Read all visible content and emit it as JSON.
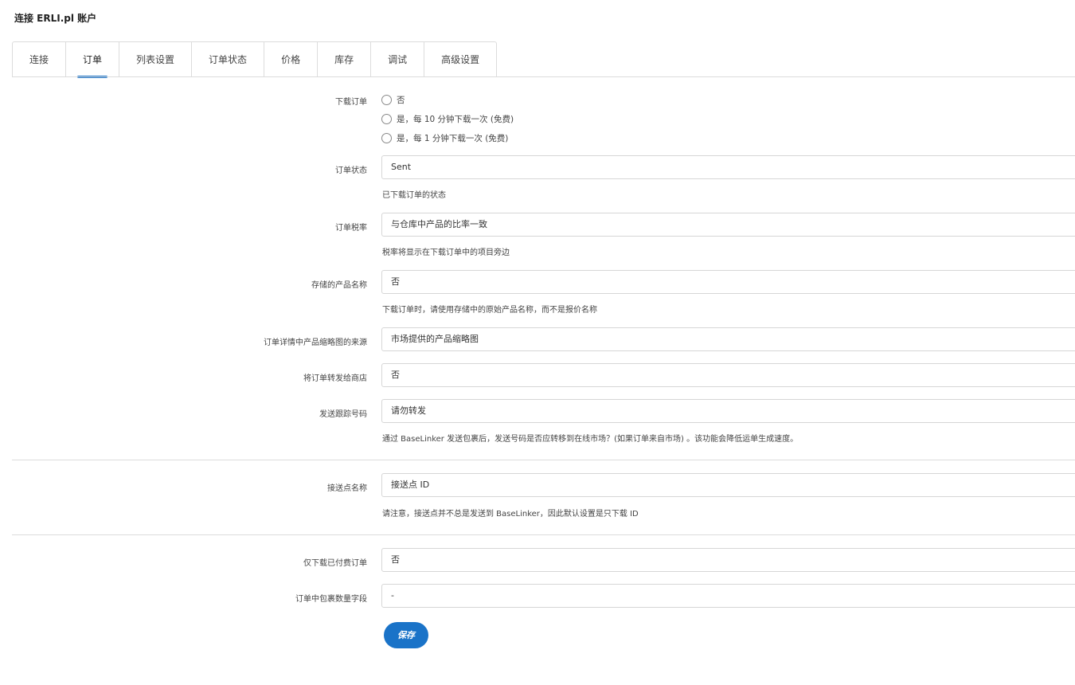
{
  "page": {
    "title": "连接 ERLI.pl 账户"
  },
  "tabs": [
    {
      "label": "连接"
    },
    {
      "label": "订单"
    },
    {
      "label": "列表设置"
    },
    {
      "label": "订单状态"
    },
    {
      "label": "价格"
    },
    {
      "label": "库存"
    },
    {
      "label": "调试"
    },
    {
      "label": "高级设置"
    }
  ],
  "form": {
    "download_orders": {
      "label": "下载订单",
      "options": [
        "否",
        "是，每 10 分钟下载一次 (免费)",
        "是，每 1 分钟下载一次 (免费)"
      ]
    },
    "order_status": {
      "label": "订单状态",
      "value": "Sent",
      "hint": "已下载订单的状态"
    },
    "order_tax": {
      "label": "订单税率",
      "value": "与仓库中产品的比率一致",
      "hint": "税率将显示在下载订单中的项目旁边"
    },
    "stored_product_name": {
      "label": "存储的产品名称",
      "value": "否",
      "hint": "下载订单时，请使用存储中的原始产品名称，而不是报价名称"
    },
    "thumbnail_source": {
      "label": "订单详情中产品缩略图的来源",
      "value": "市场提供的产品缩略图"
    },
    "forward_to_shop": {
      "label": "将订单转发给商店",
      "value": "否"
    },
    "tracking_number": {
      "label": "发送跟踪号码",
      "value": "请勿转发",
      "hint": "通过 BaseLinker 发送包裹后，发送号码是否应转移到在线市场？(如果订单来自市场) 。该功能会降低运单生成速度。"
    },
    "pickup_point": {
      "label": "接送点名称",
      "value": "接送点 ID",
      "hint": "请注意，接送点并不总是发送到 BaseLinker，因此默认设置是只下载 ID"
    },
    "paid_only": {
      "label": "仅下载已付费订单",
      "value": "否"
    },
    "package_count_field": {
      "label": "订单中包裹数量字段",
      "value": "-"
    }
  },
  "save_label": "保存",
  "colors": {
    "accent": "#1a73c8"
  }
}
